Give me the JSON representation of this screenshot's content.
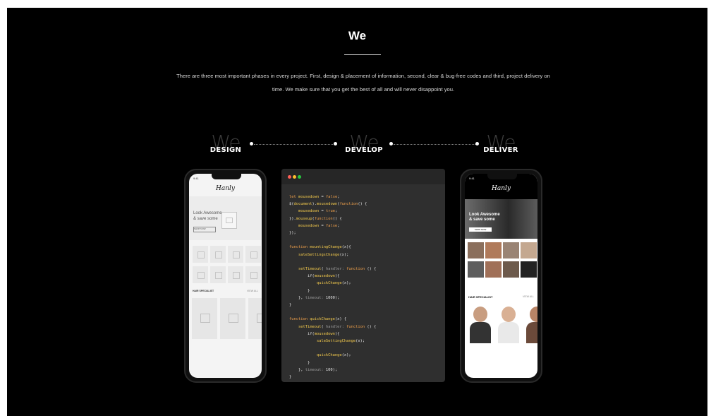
{
  "section": {
    "title": "We",
    "intro_line1": "There are three most important phases in every project. First, design & placement of information, second, clear & bug-free codes and third, project delivery on",
    "intro_line2": "time. We make sure that you get the best of all and will never disappoint you."
  },
  "phases": [
    {
      "ghost": "We",
      "label": "DESIGN"
    },
    {
      "ghost": "We",
      "label": "DEVELOP"
    },
    {
      "ghost": "We",
      "label": "DELIVER"
    }
  ],
  "left_phone": {
    "brand": "Hanly",
    "hero_text": "Look Awesome & save some",
    "hero_button": "SHOP NOW",
    "section_title": "HAIR SPECIALIST",
    "section_link": "VIEW ALL",
    "time": "9:41"
  },
  "code_editor": {
    "lines": [
      "let mousedown = false;",
      "$(document).mousedown(function() {",
      "    mousedown = true;",
      "}).mouseup(function() {",
      "    mousedown = false;",
      "});",
      "",
      "function mountingChange(x){",
      "    saleSettingsChange(x);",
      "",
      "    setTimeout( handler: function () {",
      "        if(mousedown){",
      "            quickChange(x);",
      "        }",
      "    }, timeout: 1000);",
      "}",
      "",
      "function quickChange(x) {",
      "    setTimeout( handler: function () {",
      "        if(mousedown){",
      "            saleSettingChange(x);",
      "",
      "            quickChange(x);",
      "        }",
      "    }, timeout: 100);",
      "}"
    ],
    "traffic_lights": [
      "#ff5f56",
      "#ffbd2e",
      "#27c93f"
    ]
  },
  "right_phone": {
    "brand": "Hanly",
    "hero_text": "Look Awesome & save some",
    "hero_button": "SHOP NOW",
    "section_title": "HAIR SPECIALIST",
    "section_link": "VIEW ALL",
    "time": "9:41"
  }
}
